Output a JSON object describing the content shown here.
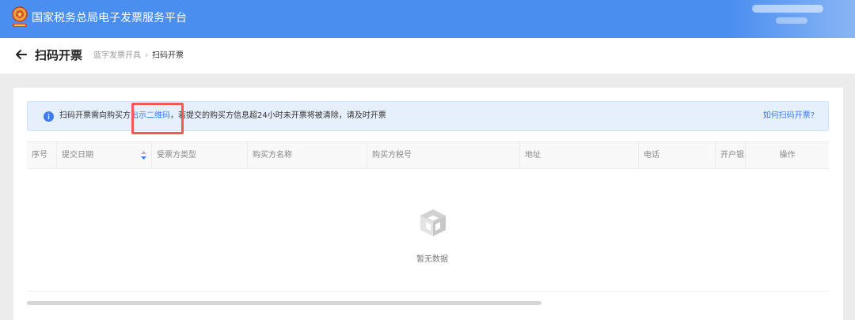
{
  "app": {
    "title": "国家税务总局电子发票服务平台",
    "brand_color": "#4a8ef0"
  },
  "header": {
    "back_icon": "arrow-left-icon",
    "page_title": "扫码开票",
    "breadcrumb": {
      "parent": "蓝字发票开具",
      "separator": "›",
      "current": "扫码开票"
    }
  },
  "notice": {
    "icon": "info-icon",
    "text_before": "扫码开票需向购买方",
    "link_text": "出示二维码",
    "text_after": "，若提交的购买方信息超24小时未开票将被清除，请及时开票",
    "help_link": "如何扫码开票?",
    "accent_color": "#3b7cf0",
    "highlight_color": "#f25858"
  },
  "table": {
    "columns": [
      {
        "label": "序号"
      },
      {
        "label": "提交日期",
        "sortable": true
      },
      {
        "label": "受票方类型"
      },
      {
        "label": "购买方名称"
      },
      {
        "label": "购买方税号"
      },
      {
        "label": "地址"
      },
      {
        "label": "电话"
      },
      {
        "label": "开户银"
      },
      {
        "label": "操作"
      }
    ],
    "rows": [],
    "empty_icon": "empty-box-icon",
    "empty_text": "暂无数据"
  }
}
